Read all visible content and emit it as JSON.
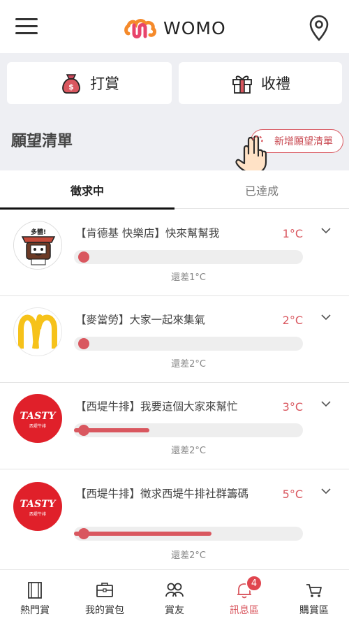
{
  "header": {
    "brand": "WOMO"
  },
  "actions": {
    "tip_label": "打賞",
    "gift_label": "收禮"
  },
  "wishlist": {
    "title": "願望清單",
    "add_button": "新增願望清單"
  },
  "tabs": [
    {
      "label": "徵求中",
      "active": true
    },
    {
      "label": "已達成",
      "active": false
    }
  ],
  "items": [
    {
      "title": "【肯德基 快樂店】快來幫幫我",
      "temp": "1°C",
      "remaining": "還差1°C",
      "progress": 0.0
    },
    {
      "title": "【麥當勞】大家一起來集氣",
      "temp": "2°C",
      "remaining": "還差2°C",
      "progress": 0.0
    },
    {
      "title": "【西堤牛排】我要這個大家來幫忙",
      "temp": "3°C",
      "remaining": "還差2°C",
      "progress": 0.33
    },
    {
      "title": "【西堤牛排】徵求西堤牛排社群籌碼",
      "temp": "5°C",
      "remaining": "還差2°C",
      "progress": 0.6
    }
  ],
  "logos": {
    "kfc_badge": "多體!",
    "tasty_brand": "TASTY",
    "tasty_sub": "西堤牛排"
  },
  "bottom_nav": [
    {
      "label": "熱門賞",
      "icon": "film-icon"
    },
    {
      "label": "我的賞包",
      "icon": "wallet-icon"
    },
    {
      "label": "賞友",
      "icon": "friends-icon"
    },
    {
      "label": "訊息區",
      "icon": "bell-icon",
      "active": true,
      "badge": "4"
    },
    {
      "label": "購賞區",
      "icon": "cart-icon"
    }
  ],
  "colors": {
    "accent": "#d9575f",
    "panel_bg": "#eeeff3",
    "mcd_yellow": "#f6c21a",
    "tasty_red": "#e0202a"
  }
}
